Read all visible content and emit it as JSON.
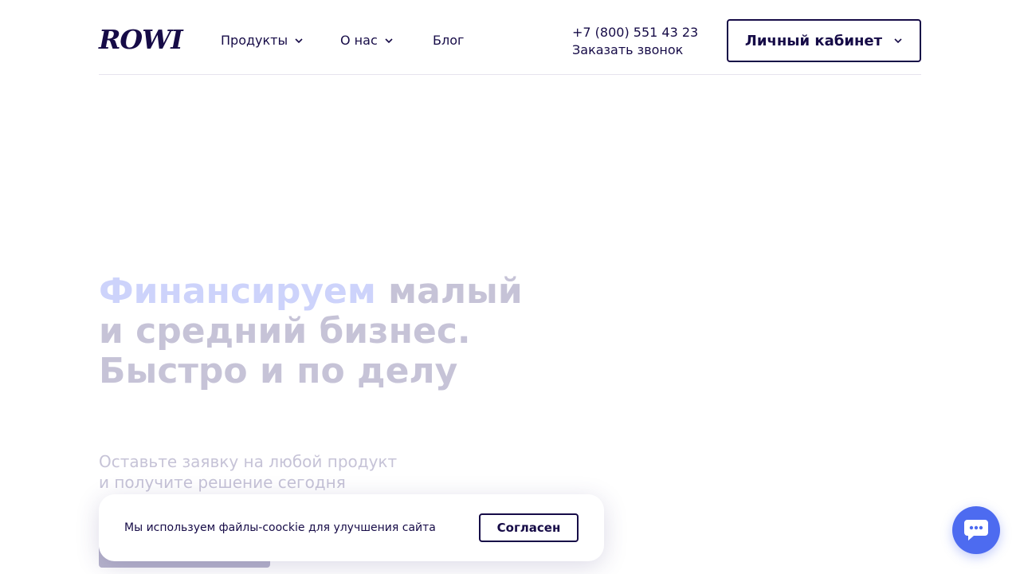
{
  "header": {
    "logo": "ROWI",
    "nav": [
      {
        "label": "Продукты",
        "has_dropdown": true
      },
      {
        "label": "О нас",
        "has_dropdown": true
      },
      {
        "label": "Блог",
        "has_dropdown": false
      }
    ],
    "phone": "+7 (800) 551 43 23",
    "callback": "Заказать звонок",
    "cabinet_label": "Личный кабинет"
  },
  "hero": {
    "title_accent": "Финансируем",
    "title_line1_rest": " малый",
    "title_line2": "и средний бизнес.",
    "title_line3": "Быстро и по делу",
    "subtitle_line1": "Оставьте заявку на любой продукт",
    "subtitle_line2": "и получите решение сегодня"
  },
  "cookie": {
    "text": "Мы используем файлы-coockie для улучшения сайта",
    "button": "Согласен"
  },
  "chat": {
    "icon": "chat-bubble-icon"
  },
  "colors": {
    "primary": "#160b47",
    "accent": "#4d6bf0",
    "muted_text": "#c6c3d7",
    "accent_faded": "#cdd3fb"
  }
}
